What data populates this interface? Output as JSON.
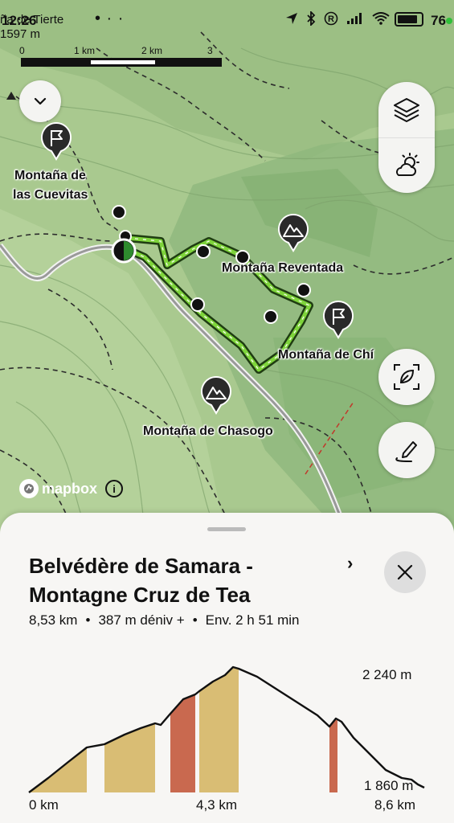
{
  "status": {
    "time": "12:26",
    "battery": "76"
  },
  "map_overlay_text": {
    "line1": "ña de Tierte",
    "line2": "1597 m"
  },
  "scale": {
    "labels": [
      "0",
      "1 km",
      "2 km",
      "3 km"
    ]
  },
  "map_labels": {
    "cuevitas_1": "Montaña de",
    "cuevitas_2": "las Cuevitas",
    "reventada": "Montaña Reventada",
    "chio": "Montaña de Chí",
    "chasogo": "Montaña de Chasogo"
  },
  "attribution": "mapbox",
  "route": {
    "title_line1": "Belvédère de Samara -",
    "title_line2": "Montagne Cruz de Tea",
    "distance": "8,53 km",
    "elevation_gain": "387 m déniv +",
    "duration": "Env. 2 h 51 min"
  },
  "profile": {
    "y_max_label": "2 240 m",
    "y_min_label": "1 860 m",
    "x_start_label": "0 km",
    "x_mid_label": "4,3 km",
    "x_end_label": "8,6 km",
    "colors": {
      "moderate": "#d9bd74",
      "steep": "#c9694f",
      "flat": "#ffffff"
    }
  }
}
